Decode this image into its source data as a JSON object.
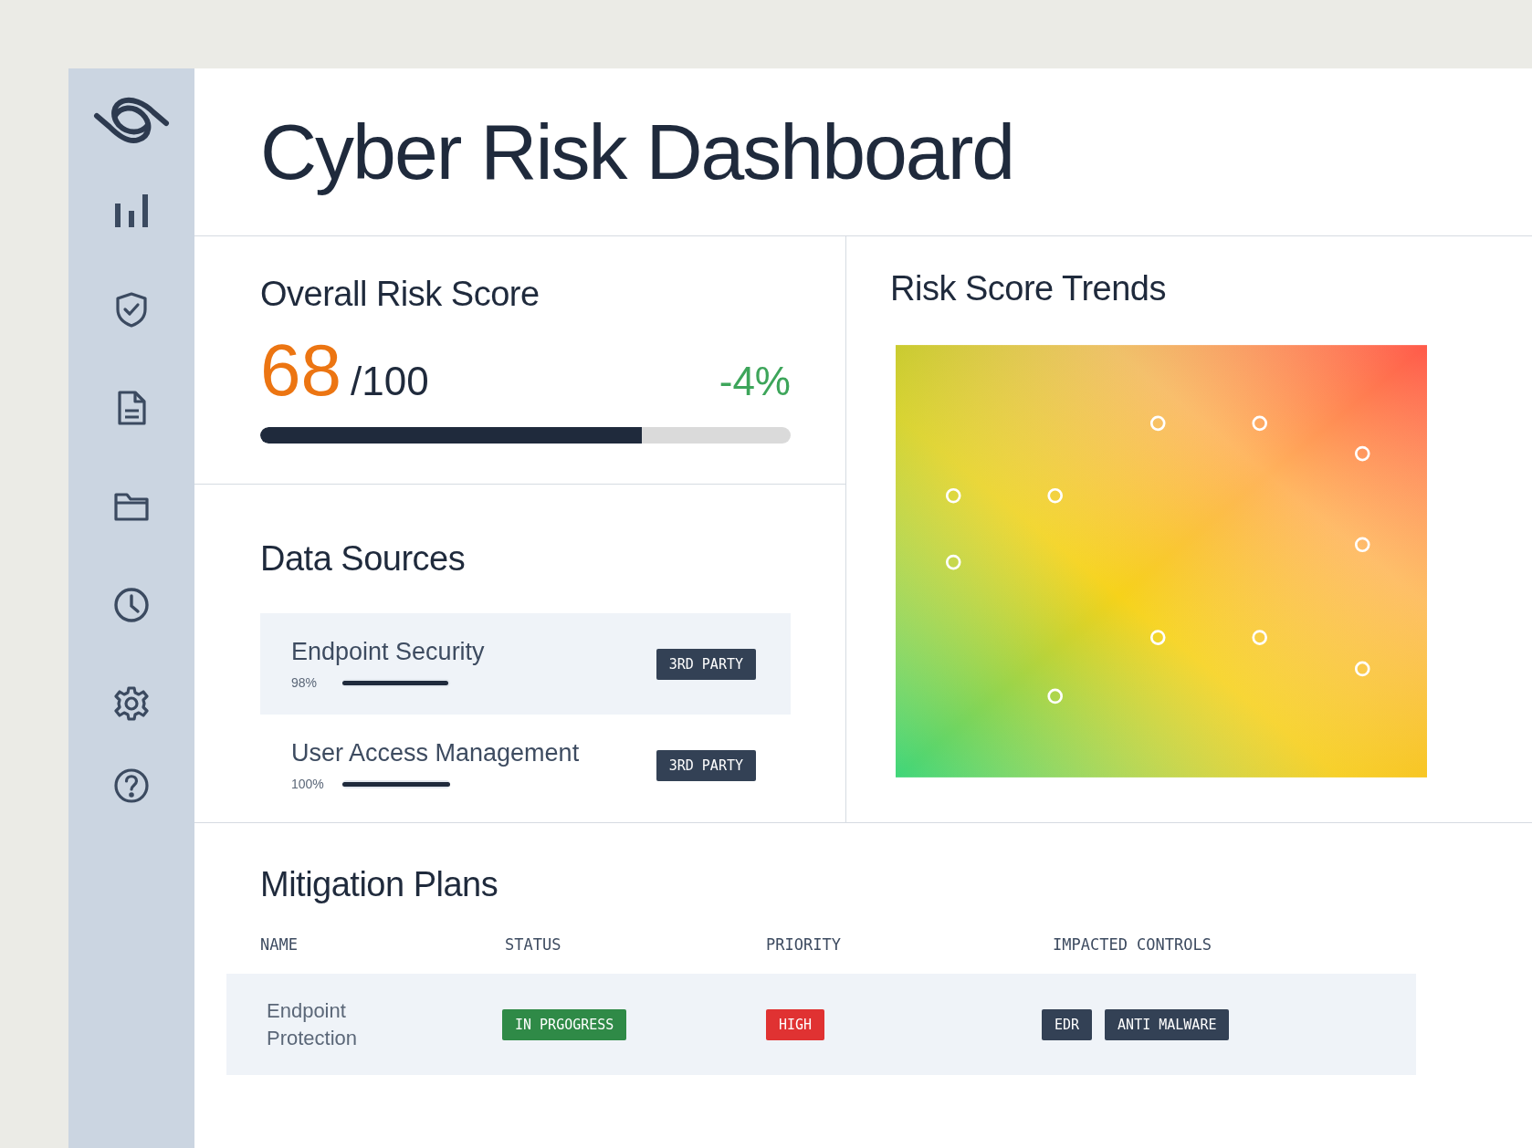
{
  "title": "Cyber Risk Dashboard",
  "overall": {
    "heading": "Overall Risk Score",
    "score": "68",
    "out_of": "/100",
    "change": "-4%",
    "level": 0.72
  },
  "trends": {
    "heading": "Risk Score Trends"
  },
  "data_sources": {
    "heading": "Data Sources",
    "items": [
      {
        "name": "Endpoint Security",
        "reading": "98%",
        "level": 0.98,
        "tag": "3RD PARTY",
        "selected": true
      },
      {
        "name": "User Access Management",
        "reading": "100%",
        "level": 1.0,
        "tag": "3RD PARTY",
        "selected": false
      }
    ]
  },
  "mitigation": {
    "heading": "Mitigation Plans",
    "columns": [
      "NAME",
      "STATUS",
      "PRIORITY",
      "IMPACTED CONTROLS"
    ],
    "rows": [
      {
        "name": "Endpoint Protection",
        "status": {
          "label": "IN PRGOGRESS",
          "kind": "in_progress"
        },
        "priority": {
          "label": "HIGH",
          "kind": "high"
        },
        "controls": [
          "EDR",
          "ANTI MALWARE"
        ]
      }
    ]
  }
}
